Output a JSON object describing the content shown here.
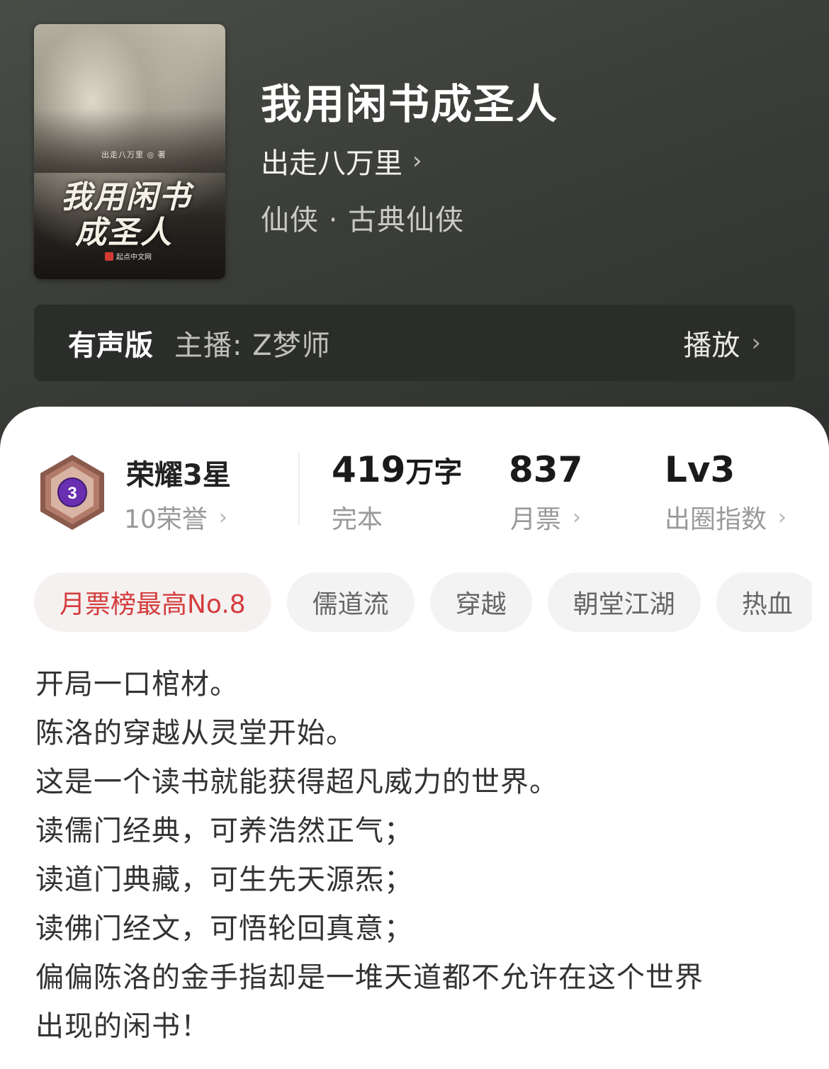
{
  "book": {
    "title": "我用闲书成圣人",
    "author": "出走八万里",
    "genre": "仙侠 · 古典仙侠",
    "cover": {
      "author_line": "出走八万里 ◎ 著",
      "title_line1": "我用闲书",
      "title_line2": "成圣人",
      "publisher": "起点中文网"
    }
  },
  "audio": {
    "tag": "有声版",
    "host": "主播: Z梦师",
    "play_label": "播放"
  },
  "stats": {
    "honor_title": "荣耀3星",
    "honor_count": "10荣誉",
    "honor_level": "3",
    "words_value": "419",
    "words_unit": "万字",
    "words_label": "完本",
    "votes_value": "837",
    "votes_label": "月票",
    "influence_value": "Lv3",
    "influence_label": "出圈指数"
  },
  "tags": [
    "月票榜最高No.8",
    "儒道流",
    "穿越",
    "朝堂江湖",
    "热血"
  ],
  "description": [
    "开局一口棺材。",
    "陈洛的穿越从灵堂开始。",
    "这是一个读书就能获得超凡威力的世界。",
    "读儒门经典，可养浩然正气；",
    "读道门典藏，可生先天源炁；",
    "读佛门经文，可悟轮回真意；",
    "偏偏陈洛的金手指却是一堆天道都不允许在这个世界",
    "出现的闲书！"
  ],
  "colors": {
    "hero_bg": "#3d3f3b",
    "audio_bar": "#2b2d2a",
    "accent_red": "#d53c3c",
    "badge_purple": "#6a2fb0",
    "badge_bronze": "#8a5a4c"
  }
}
